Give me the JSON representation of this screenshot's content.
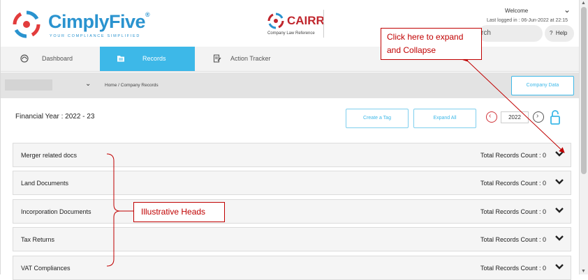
{
  "brand": {
    "name": "CimplyFive",
    "reg": "®",
    "tagline": "YOUR COMPLIANCE SIMPLIFIED",
    "partner_name": "CAIRR",
    "partner_sub": "Company Law Reference"
  },
  "user": {
    "welcome": "Welcome",
    "last_login": "Last logged in : 06-Jun-2022 at 22:15"
  },
  "search": {
    "visible_text": "rch"
  },
  "help": {
    "label": "Help"
  },
  "nav": {
    "tabs": [
      {
        "label": "Dashboard",
        "icon": "dashboard-icon",
        "active": false
      },
      {
        "label": "Records",
        "icon": "folder-icon",
        "active": true
      },
      {
        "label": "Action Tracker",
        "icon": "action-tracker-icon",
        "active": false
      }
    ]
  },
  "toolbar": {
    "breadcrumb": "Home  /  Company Records",
    "company_data_label": "Company Data"
  },
  "filters": {
    "financial_year": "Financial Year : 2022 - 23",
    "create_tag_label": "Create a Tag",
    "expand_all_label": "Expand All",
    "year": "2022"
  },
  "records": [
    {
      "name": "Merger related docs",
      "count_label": "Total Records Count : 0"
    },
    {
      "name": "Land Documents",
      "count_label": "Total Records Count : 0"
    },
    {
      "name": "Incorporation Documents",
      "count_label": "Total Records Count : 0"
    },
    {
      "name": "Tax Returns",
      "count_label": "Total Records Count : 0"
    },
    {
      "name": "VAT Compliances",
      "count_label": "Total Records Count : 0"
    }
  ],
  "annotations": {
    "expand_line1": "Click here to expand",
    "expand_line2": "and Collapse",
    "heads": "Illustrative Heads"
  },
  "colors": {
    "brand_blue": "#2a93cf",
    "active_tab": "#3db8e8",
    "partner_red": "#c0262d",
    "annotation_red": "#c00000"
  }
}
